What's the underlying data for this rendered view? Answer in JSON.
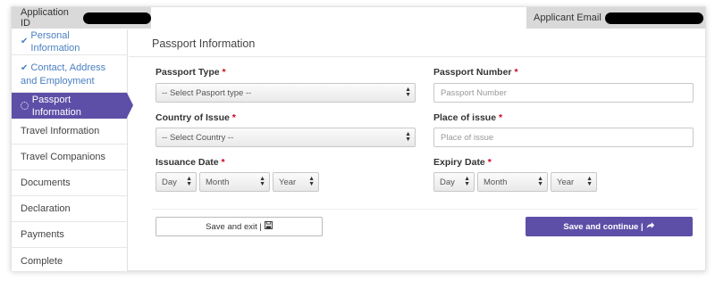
{
  "header": {
    "application_id_label": "Application ID",
    "applicant_email_label": "Applicant Email"
  },
  "sidebar": {
    "items": [
      {
        "label": "Personal Information",
        "state": "done"
      },
      {
        "label": "Contact, Address and Employment",
        "state": "done"
      },
      {
        "label": "Passport Information",
        "state": "active"
      },
      {
        "label": "Travel Information",
        "state": "pending"
      },
      {
        "label": "Travel Companions",
        "state": "pending"
      },
      {
        "label": "Documents",
        "state": "pending"
      },
      {
        "label": "Declaration",
        "state": "pending"
      },
      {
        "label": "Payments",
        "state": "pending"
      },
      {
        "label": "Complete",
        "state": "pending"
      }
    ]
  },
  "form": {
    "title": "Passport Information",
    "passport_type": {
      "label": "Passport Type",
      "value": "-- Select Pasport type --"
    },
    "passport_number": {
      "label": "Passport Number",
      "placeholder": "Passport Number"
    },
    "country_of_issue": {
      "label": "Country of Issue",
      "value": "-- Select Country --"
    },
    "place_of_issue": {
      "label": "Place of issue",
      "placeholder": "Place of issue"
    },
    "issuance_date": {
      "label": "Issuance Date",
      "day": "Day",
      "month": "Month",
      "year": "Year"
    },
    "expiry_date": {
      "label": "Expiry Date",
      "day": "Day",
      "month": "Month",
      "year": "Year"
    },
    "required_marker": "*"
  },
  "buttons": {
    "save_exit": "Save and exit |",
    "save_continue": "Save and continue |"
  },
  "colors": {
    "accent": "#5d4fa7",
    "link": "#4a7fc1",
    "required": "#d0021b"
  }
}
